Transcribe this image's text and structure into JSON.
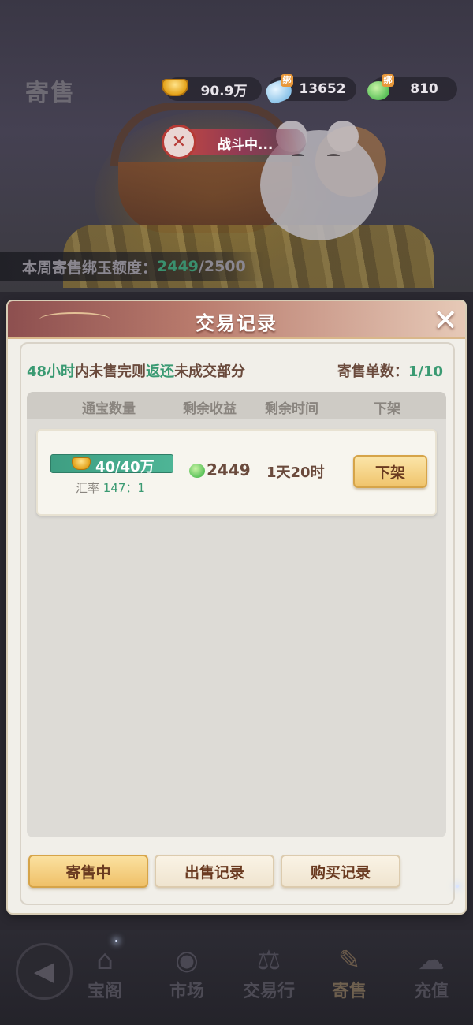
{
  "header": {
    "title": "寄售",
    "currencies": {
      "gold": {
        "value": "90.9万",
        "icon": "gold-ingot-icon"
      },
      "blue_jade": {
        "value": "13652",
        "tag": "绑",
        "icon": "blue-jade-icon"
      },
      "green_jade": {
        "value": "810",
        "tag": "绑",
        "icon": "green-jade-icon"
      }
    },
    "battle_status": "战斗中...",
    "quota": {
      "label": "本周寄售绑玉额度：",
      "current": "2449",
      "max": "/2500"
    }
  },
  "modal": {
    "title": "交易记录",
    "notice": {
      "part1": "48小时",
      "part2": "内未售完则",
      "part3": "返还",
      "part4": "未成交部分"
    },
    "order_count": {
      "label": "寄售单数：",
      "value": "1/10"
    },
    "columns": [
      "通宝数量",
      "剩余收益",
      "剩余时间",
      "下架"
    ],
    "rows": [
      {
        "amount": "40/40万",
        "rate_label": "汇率",
        "rate_value": "147：1",
        "income": "2449",
        "time_left": "1天20时",
        "action": "下架"
      }
    ],
    "tabs": [
      "寄售中",
      "出售记录",
      "购买记录"
    ],
    "active_tab": "寄售中"
  },
  "bottom_nav": {
    "items": [
      {
        "label": "宝阁",
        "icon": "pavilion-icon"
      },
      {
        "label": "市场",
        "icon": "coin-icon"
      },
      {
        "label": "交易行",
        "icon": "scale-icon"
      },
      {
        "label": "寄售",
        "icon": "scroll-icon"
      },
      {
        "label": "充值",
        "icon": "cloud-icon"
      }
    ],
    "active": "寄售"
  },
  "colors": {
    "accent_green": "#3a9a72",
    "brown_text": "#6a4a3c",
    "button_gold": "#f0c46c",
    "header_red": "#8d4f4f"
  }
}
